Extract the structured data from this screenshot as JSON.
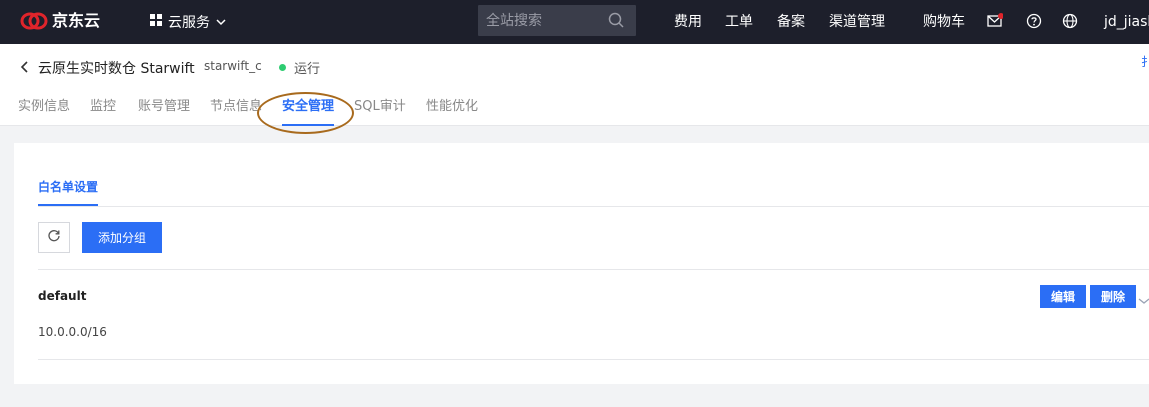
{
  "topbar": {
    "brand": "京东云",
    "service_menu": "云服务",
    "search_placeholder": "全站搜索",
    "links": [
      "费用",
      "工单",
      "备案",
      "渠道管理",
      "购物车"
    ],
    "user": "jd_jiash",
    "icons": [
      "mail-icon",
      "help-icon",
      "globe-icon"
    ],
    "mail_badge_color": "#e0242b"
  },
  "header": {
    "title": "云原生实时数仓 Starwift",
    "instance_id": "starwift_c",
    "status": "运行",
    "status_color": "#2ecc71",
    "edge_char": "扌"
  },
  "tabs": [
    {
      "label": "实例信息",
      "active": false
    },
    {
      "label": "监控",
      "active": false
    },
    {
      "label": "账号管理",
      "active": false
    },
    {
      "label": "节点信息",
      "active": false
    },
    {
      "label": "安全管理",
      "active": true
    },
    {
      "label": "SQL审计",
      "active": false
    },
    {
      "label": "性能优化",
      "active": false
    }
  ],
  "panel": {
    "subtab": "白名单设置",
    "add_button": "添加分组",
    "groups": [
      {
        "name": "default",
        "ip": "10.0.0.0/16",
        "edit_label": "编辑",
        "delete_label": "删除"
      }
    ]
  },
  "colors": {
    "accent": "#2b6ef5",
    "topbar_bg": "#1d1f2b",
    "annotation": "#a86a1d"
  }
}
